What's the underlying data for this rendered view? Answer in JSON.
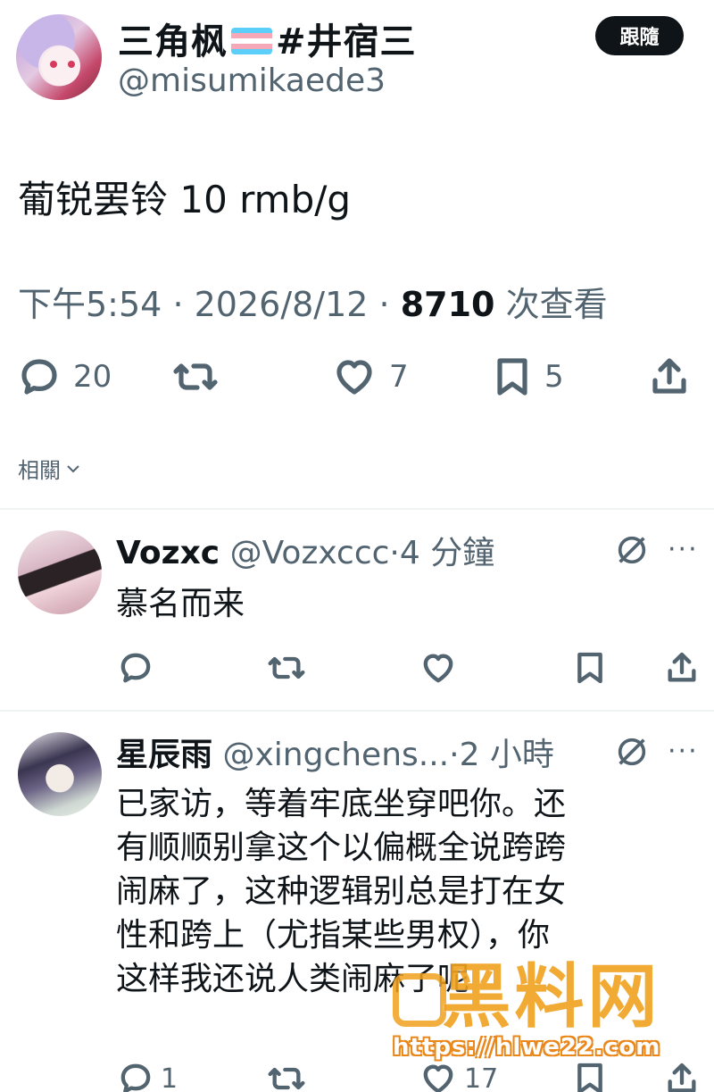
{
  "main_tweet": {
    "display_name": "三角枫",
    "display_name_suffix": "#井宿三",
    "flag": "transgender-flag-emoji",
    "handle": "@misumikaede3",
    "follow_label": "跟隨",
    "text": "葡锐罢铃 10 rmb/g",
    "time": "下午5:54",
    "date": "2026/8/12",
    "views_count": "8710",
    "views_label": "次查看",
    "reply_count": "20",
    "retweet_count": "",
    "like_count": "7",
    "bookmark_count": "5"
  },
  "related_label": "相關",
  "replies": [
    {
      "display_name": "Vozxc",
      "handle": "@Vozxccc",
      "time": "4 分鐘",
      "text": "慕名而来",
      "reply_count": "",
      "retweet_count": "",
      "like_count": ""
    },
    {
      "display_name": "星辰雨",
      "handle": "@xingchens...",
      "time": "2 小時",
      "text_lines": [
        "已家访，等着牢底坐穿吧你。还",
        "有顺顺别拿这个以偏概全说跨跨",
        "闹麻了，这种逻辑别总是打在女",
        "性和跨上（尤指某些男权），你",
        "这样我还说人类闹麻了呢"
      ],
      "reply_count": "1",
      "retweet_count": "",
      "like_count": "17"
    }
  ],
  "watermark": {
    "text": "黑料网",
    "url": "https://hlwe22.com"
  },
  "colors": {
    "text": "#0f1419",
    "secondary": "#536471",
    "divider": "#eff3f4",
    "watermark": "#f0a11d"
  }
}
